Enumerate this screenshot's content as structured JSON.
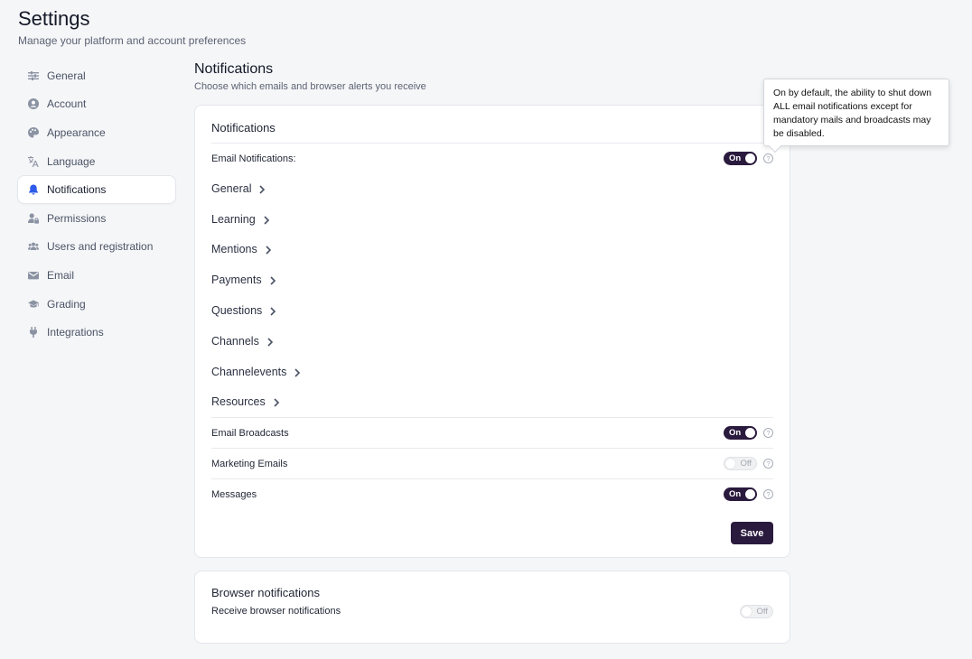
{
  "header": {
    "title": "Settings",
    "subtitle": "Manage your platform and account preferences"
  },
  "sidebar": {
    "items": [
      {
        "label": "General",
        "icon": "sliders-icon",
        "active": false
      },
      {
        "label": "Account",
        "icon": "user-circle-icon",
        "active": false
      },
      {
        "label": "Appearance",
        "icon": "palette-icon",
        "active": false
      },
      {
        "label": "Language",
        "icon": "translate-icon",
        "active": false
      },
      {
        "label": "Notifications",
        "icon": "bell-icon",
        "active": true
      },
      {
        "label": "Permissions",
        "icon": "user-lock-icon",
        "active": false
      },
      {
        "label": "Users and registration",
        "icon": "users-icon",
        "active": false
      },
      {
        "label": "Email",
        "icon": "envelope-icon",
        "active": false
      },
      {
        "label": "Grading",
        "icon": "graduation-cap-icon",
        "active": false
      },
      {
        "label": "Integrations",
        "icon": "plug-icon",
        "active": false
      }
    ]
  },
  "main": {
    "title": "Notifications",
    "subtitle": "Choose which emails and browser alerts you receive"
  },
  "notifications_card": {
    "title": "Notifications",
    "email_notifications": {
      "label": "Email Notifications:",
      "state": "On"
    },
    "categories": [
      "General",
      "Learning",
      "Mentions",
      "Payments",
      "Questions",
      "Channels",
      "Channelevents",
      "Resources"
    ],
    "email_broadcasts": {
      "label": "Email Broadcasts",
      "state": "On"
    },
    "marketing_emails": {
      "label": "Marketing Emails",
      "state": "Off"
    },
    "messages": {
      "label": "Messages",
      "state": "On"
    },
    "save_label": "Save",
    "help_glyph": "?"
  },
  "browser_card": {
    "title": "Browser notifications",
    "receive": {
      "label": "Receive browser notifications",
      "state": "Off"
    }
  },
  "tooltip": {
    "text": "On by default, the ability to shut down ALL email notifications except for mandatory mails and broadcasts may be disabled."
  },
  "colors": {
    "accent_dark": "#2a1a3e",
    "active_icon": "#2f5bea",
    "background": "#f5f6f8"
  }
}
